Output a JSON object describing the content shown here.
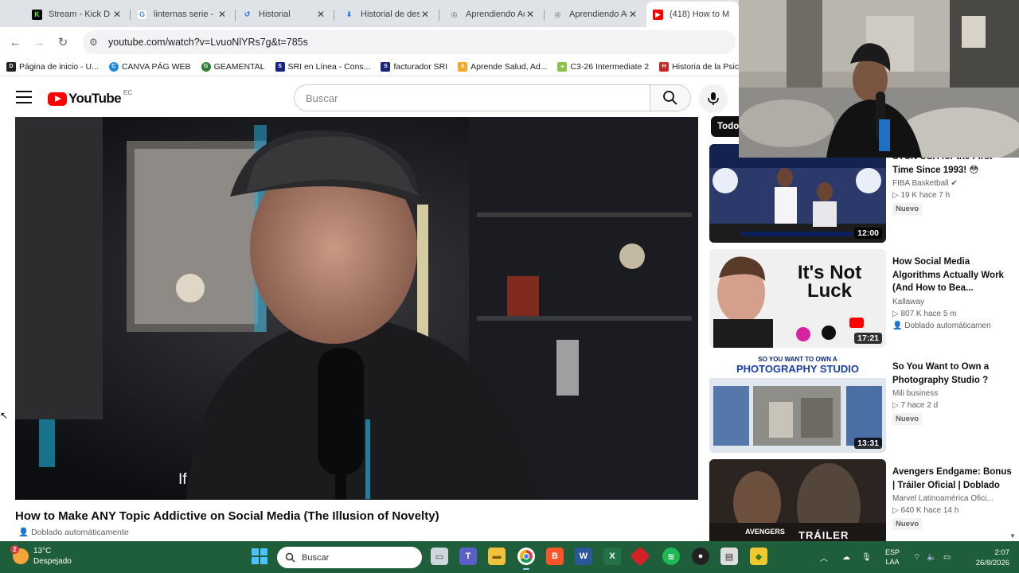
{
  "browser": {
    "tabs": [
      {
        "title": "Stream - Kick D",
        "favicon": "kick-icon",
        "color": "#53fc18"
      },
      {
        "title": "linternas serie -",
        "favicon": "google-icon",
        "color": "#4285f4"
      },
      {
        "title": "Historial",
        "favicon": "history-icon",
        "color": "#1a73e8"
      },
      {
        "title": "Historial de des",
        "favicon": "download-icon",
        "color": "#1a73e8"
      },
      {
        "title": "Aprendiendo Ac",
        "favicon": "globe-icon",
        "color": "#5f6368"
      },
      {
        "title": "Aprendiendo Ac",
        "favicon": "globe-icon",
        "color": "#5f6368"
      },
      {
        "title": "(418) How to M",
        "favicon": "youtube-icon",
        "color": "#ff0000"
      }
    ],
    "url": "youtube.com/watch?v=LvuoNlYRs7g&t=785s",
    "bookmarks": [
      {
        "label": "Página de inicio - U...",
        "icon": "dzl-icon",
        "color": "#222"
      },
      {
        "label": "CANVA PÁG WEB",
        "icon": "canva-icon",
        "color": "#1e88e5"
      },
      {
        "label": "GEAMENTAL",
        "icon": "geamental-icon",
        "color": "#2e7d32"
      },
      {
        "label": "SRI en Línea - Cons...",
        "icon": "sri-icon",
        "color": "#1a237e"
      },
      {
        "label": "facturador SRI",
        "icon": "sri-icon",
        "color": "#1a237e"
      },
      {
        "label": "Aprende Salud, Ad...",
        "icon": "aprende-icon",
        "color": "#f9a825"
      },
      {
        "label": "C3-26 Intermediate 2",
        "icon": "c3-icon",
        "color": "#8bc34a"
      },
      {
        "label": "Historia de la Psicol...",
        "icon": "historia-icon",
        "color": "#c62828"
      }
    ]
  },
  "youtube": {
    "logo_text": "YouTube",
    "country_code": "EC",
    "search_placeholder": "Buscar",
    "video": {
      "caption": "If",
      "title": "How to Make ANY Topic Addictive on Social Media (The Illusion of Novelty)",
      "dub_label": "Doblado automáticamente"
    },
    "chip_label": "Todo",
    "recommendations": [
      {
        "title": "STUN USA for the First Time Since 1993! 😳",
        "channel": "FIBA Basketball",
        "verified": true,
        "stats": "▷ 19 K  hace 7 h",
        "badge": "Nuevo",
        "duration": "12:00"
      },
      {
        "title": "How Social Media Algorithms Actually Work (And How to Bea...",
        "channel": "Kallaway",
        "stats": "▷ 807 K  hace 5 m",
        "dub": "Doblado automáticamen",
        "duration": "17:21",
        "thumb_text_1": "It's Not",
        "thumb_text_2": "Luck"
      },
      {
        "title": "So You Want to Own a Photography Studio ?",
        "channel": "Mili business",
        "stats": "▷ 7  hace 2 d",
        "badge": "Nuevo",
        "duration": "13:31",
        "thumb_text_1": "SO YOU WANT TO OWN A",
        "thumb_text_2": "PHOTOGRAPHY STUDIO"
      },
      {
        "title": "Avengers Endgame: Bonus | Tráiler Oficial | Doblado",
        "channel": "Marvel Latinoamérica Ofici...",
        "stats": "▷ 640 K  hace 14 h",
        "badge": "Nuevo",
        "thumb_text_1": "TRÁILER",
        "thumb_text_2": "AVENGERS"
      }
    ]
  },
  "taskbar": {
    "weather_temp": "13°C",
    "weather_desc": "Despejado",
    "weather_alert": "2",
    "search_placeholder": "Buscar",
    "lang_1": "ESP",
    "lang_2": "LAA",
    "time": "2:07",
    "date": "26/8/2026"
  }
}
